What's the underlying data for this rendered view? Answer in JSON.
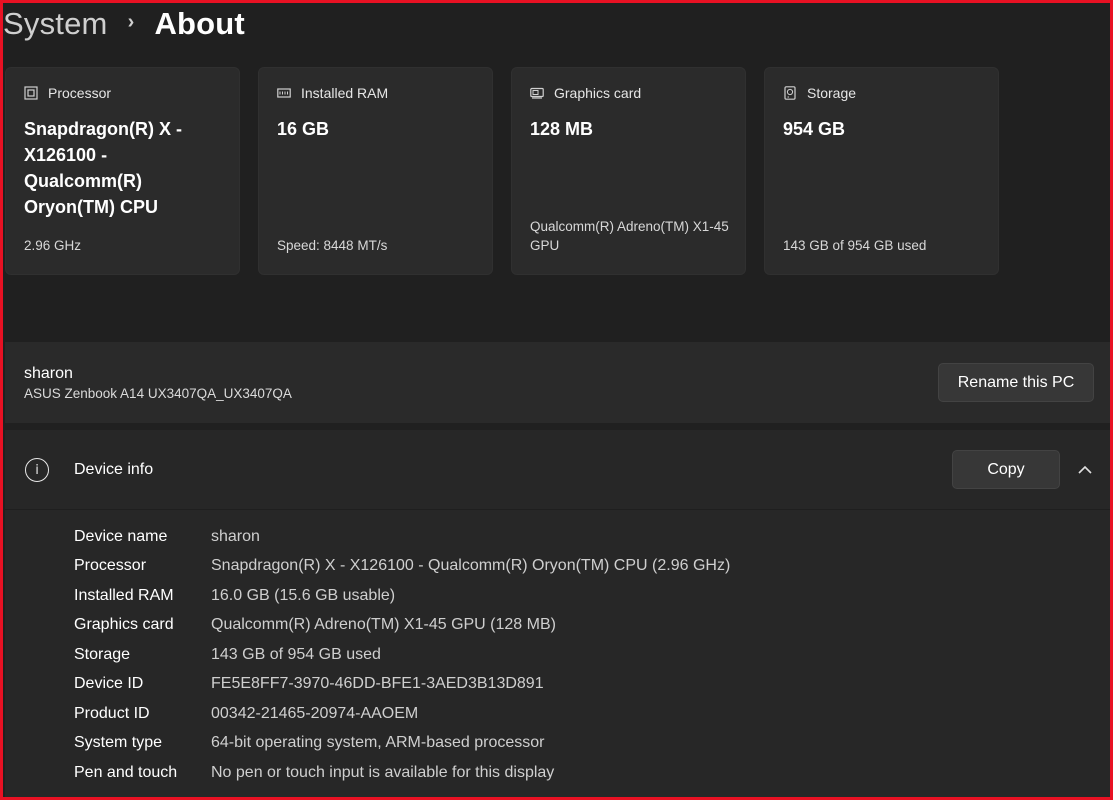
{
  "breadcrumb": {
    "parent": "System",
    "separator": "›",
    "current": "About"
  },
  "cards": [
    {
      "icon": "processor-icon",
      "label": "Processor",
      "value": "Snapdragon(R) X - X126100 - Qualcomm(R) Oryon(TM) CPU",
      "sub": "2.96 GHz"
    },
    {
      "icon": "ram-icon",
      "label": "Installed RAM",
      "value": "16 GB",
      "sub": "Speed: 8448 MT/s"
    },
    {
      "icon": "graphics-card-icon",
      "label": "Graphics card",
      "value": "128 MB",
      "sub": "Qualcomm(R) Adreno(TM) X1-45 GPU"
    },
    {
      "icon": "storage-icon",
      "label": "Storage",
      "value": "954 GB",
      "sub": "143 GB of 954 GB used"
    }
  ],
  "pc": {
    "name": "sharon",
    "model": "ASUS Zenbook A14 UX3407QA_UX3407QA",
    "rename_label": "Rename this PC"
  },
  "device_info": {
    "title": "Device info",
    "copy_label": "Copy",
    "rows": [
      {
        "label": "Device name",
        "value": "sharon"
      },
      {
        "label": "Processor",
        "value": "Snapdragon(R) X - X126100 - Qualcomm(R) Oryon(TM) CPU (2.96 GHz)"
      },
      {
        "label": "Installed RAM",
        "value": "16.0 GB (15.6 GB usable)"
      },
      {
        "label": "Graphics card",
        "value": "Qualcomm(R) Adreno(TM) X1-45 GPU (128 MB)"
      },
      {
        "label": "Storage",
        "value": "143 GB of 954 GB used"
      },
      {
        "label": "Device ID",
        "value": "FE5E8FF7-3970-46DD-BFE1-3AED3B13D891"
      },
      {
        "label": "Product ID",
        "value": "00342-21465-20974-AAOEM"
      },
      {
        "label": "System type",
        "value": "64-bit operating system, ARM-based processor"
      },
      {
        "label": "Pen and touch",
        "value": "No pen or touch input is available for this display"
      }
    ]
  },
  "colors": {
    "frame": "#e81123",
    "background": "#202020",
    "card": "#2b2b2b"
  }
}
